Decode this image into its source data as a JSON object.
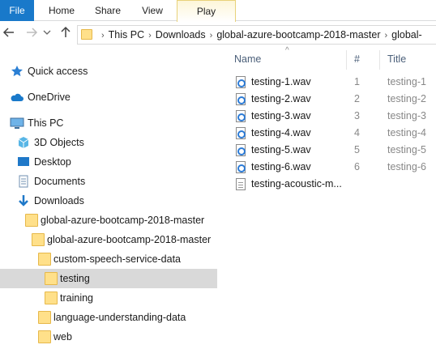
{
  "ribbon": {
    "tabs": {
      "file": "File",
      "home": "Home",
      "share": "Share",
      "view": "View",
      "play": "Play"
    }
  },
  "address": {
    "crumbs": [
      "This PC",
      "Downloads",
      "global-azure-bootcamp-2018-master",
      "global-"
    ]
  },
  "nav": {
    "items": {
      "quick_access": "Quick access",
      "onedrive": "OneDrive",
      "this_pc": "This PC",
      "objects3d": "3D Objects",
      "desktop": "Desktop",
      "documents": "Documents",
      "downloads": "Downloads",
      "gab1": "global-azure-bootcamp-2018-master",
      "gab2": "global-azure-bootcamp-2018-master",
      "custom_speech": "custom-speech-service-data",
      "testing": "testing",
      "training": "training",
      "language": "language-understanding-data",
      "web": "web"
    }
  },
  "filelist": {
    "columns": {
      "name": "Name",
      "number": "#",
      "title": "Title"
    },
    "rows": [
      {
        "name": "testing-1.wav",
        "num": "1",
        "title": "testing-1"
      },
      {
        "name": "testing-2.wav",
        "num": "2",
        "title": "testing-2"
      },
      {
        "name": "testing-3.wav",
        "num": "3",
        "title": "testing-3"
      },
      {
        "name": "testing-4.wav",
        "num": "4",
        "title": "testing-4"
      },
      {
        "name": "testing-5.wav",
        "num": "5",
        "title": "testing-5"
      },
      {
        "name": "testing-6.wav",
        "num": "6",
        "title": "testing-6"
      },
      {
        "name": "testing-acoustic-m...",
        "num": "",
        "title": ""
      }
    ]
  },
  "colors": {
    "accent": "#1979ca",
    "selected": "#d9d9d9",
    "folder": "#ffe08a"
  }
}
